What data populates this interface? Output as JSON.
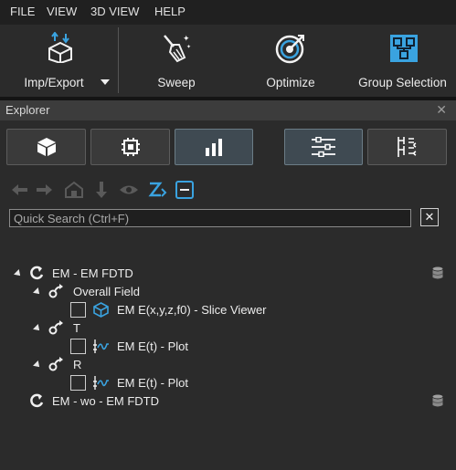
{
  "menu": [
    "FILE",
    "VIEW",
    "3D VIEW",
    "HELP"
  ],
  "ribbon": {
    "imp_export": "Imp/Export",
    "sweep": "Sweep",
    "optimize": "Optimize",
    "group_selection": "Group Selection"
  },
  "explorer": {
    "title": "Explorer",
    "close": "✕",
    "search_placeholder": "Quick Search (Ctrl+F)",
    "search_clear": "✕"
  },
  "tree": {
    "em_fdtd": "EM - EM FDTD",
    "overall_field": "Overall Field",
    "slice_viewer": "EM E(x,y,z,f0) - Slice Viewer",
    "t": "T",
    "t_plot": "EM E(t) - Plot",
    "r": "R",
    "r_plot": "EM E(t) - Plot",
    "em_wo": "EM - wo - EM FDTD"
  },
  "colors": {
    "accent_blue": "#3aa3e0",
    "bg": "#2b2b2b",
    "menubar": "#202020",
    "active_tab": "#3f4a52"
  }
}
